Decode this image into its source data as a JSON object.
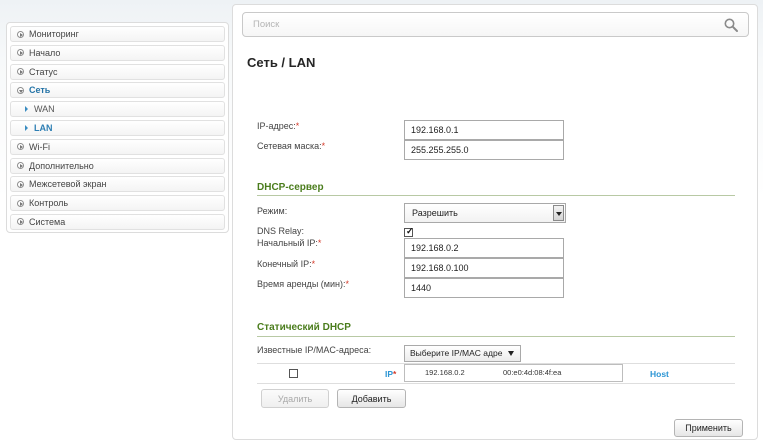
{
  "sidebar": {
    "items": [
      {
        "label": "Мониторинг"
      },
      {
        "label": "Начало"
      },
      {
        "label": "Статус"
      },
      {
        "label": "Сеть"
      },
      {
        "label": "WAN"
      },
      {
        "label": "LAN"
      },
      {
        "label": "Wi-Fi"
      },
      {
        "label": "Дополнительно"
      },
      {
        "label": "Межсетевой экран"
      },
      {
        "label": "Контроль"
      },
      {
        "label": "Система"
      }
    ]
  },
  "search": {
    "placeholder": "Поиск"
  },
  "page": {
    "title": "Сеть /  LAN"
  },
  "lan": {
    "ip_label": "IP-адрес:",
    "ip_value": "192.168.0.1",
    "mask_label": "Сетевая маска:",
    "mask_value": "255.255.255.0"
  },
  "dhcp": {
    "section_title": "DHCP-сервер",
    "mode_label": "Режим:",
    "mode_value": "Разрешить",
    "dns_relay_label": "DNS Relay:",
    "dns_relay_checked": true,
    "start_ip_label": "Начальный IP:",
    "start_ip_value": "192.168.0.2",
    "end_ip_label": "Конечный IP:",
    "end_ip_value": "192.168.0.100",
    "lease_label": "Время аренды (мин):",
    "lease_value": "1440"
  },
  "static_dhcp": {
    "section_title": "Статический DHCP",
    "known_label": "Известные IP/MAC-адреса:",
    "known_select": "Выберите IP/MAC адре",
    "col_ip": "IP",
    "col_host": "Host",
    "entry_ip": "192.168.0.2",
    "entry_mac": "00:e0:4d:08:4f:ea",
    "delete_label": "Удалить",
    "add_label": "Добавить"
  },
  "apply_label": "Применить",
  "required_mark": "*",
  "colors": {
    "accent": "#2473a6",
    "section": "#4b7d1d",
    "required": "#d43a2a",
    "column": "#2b95d4"
  }
}
